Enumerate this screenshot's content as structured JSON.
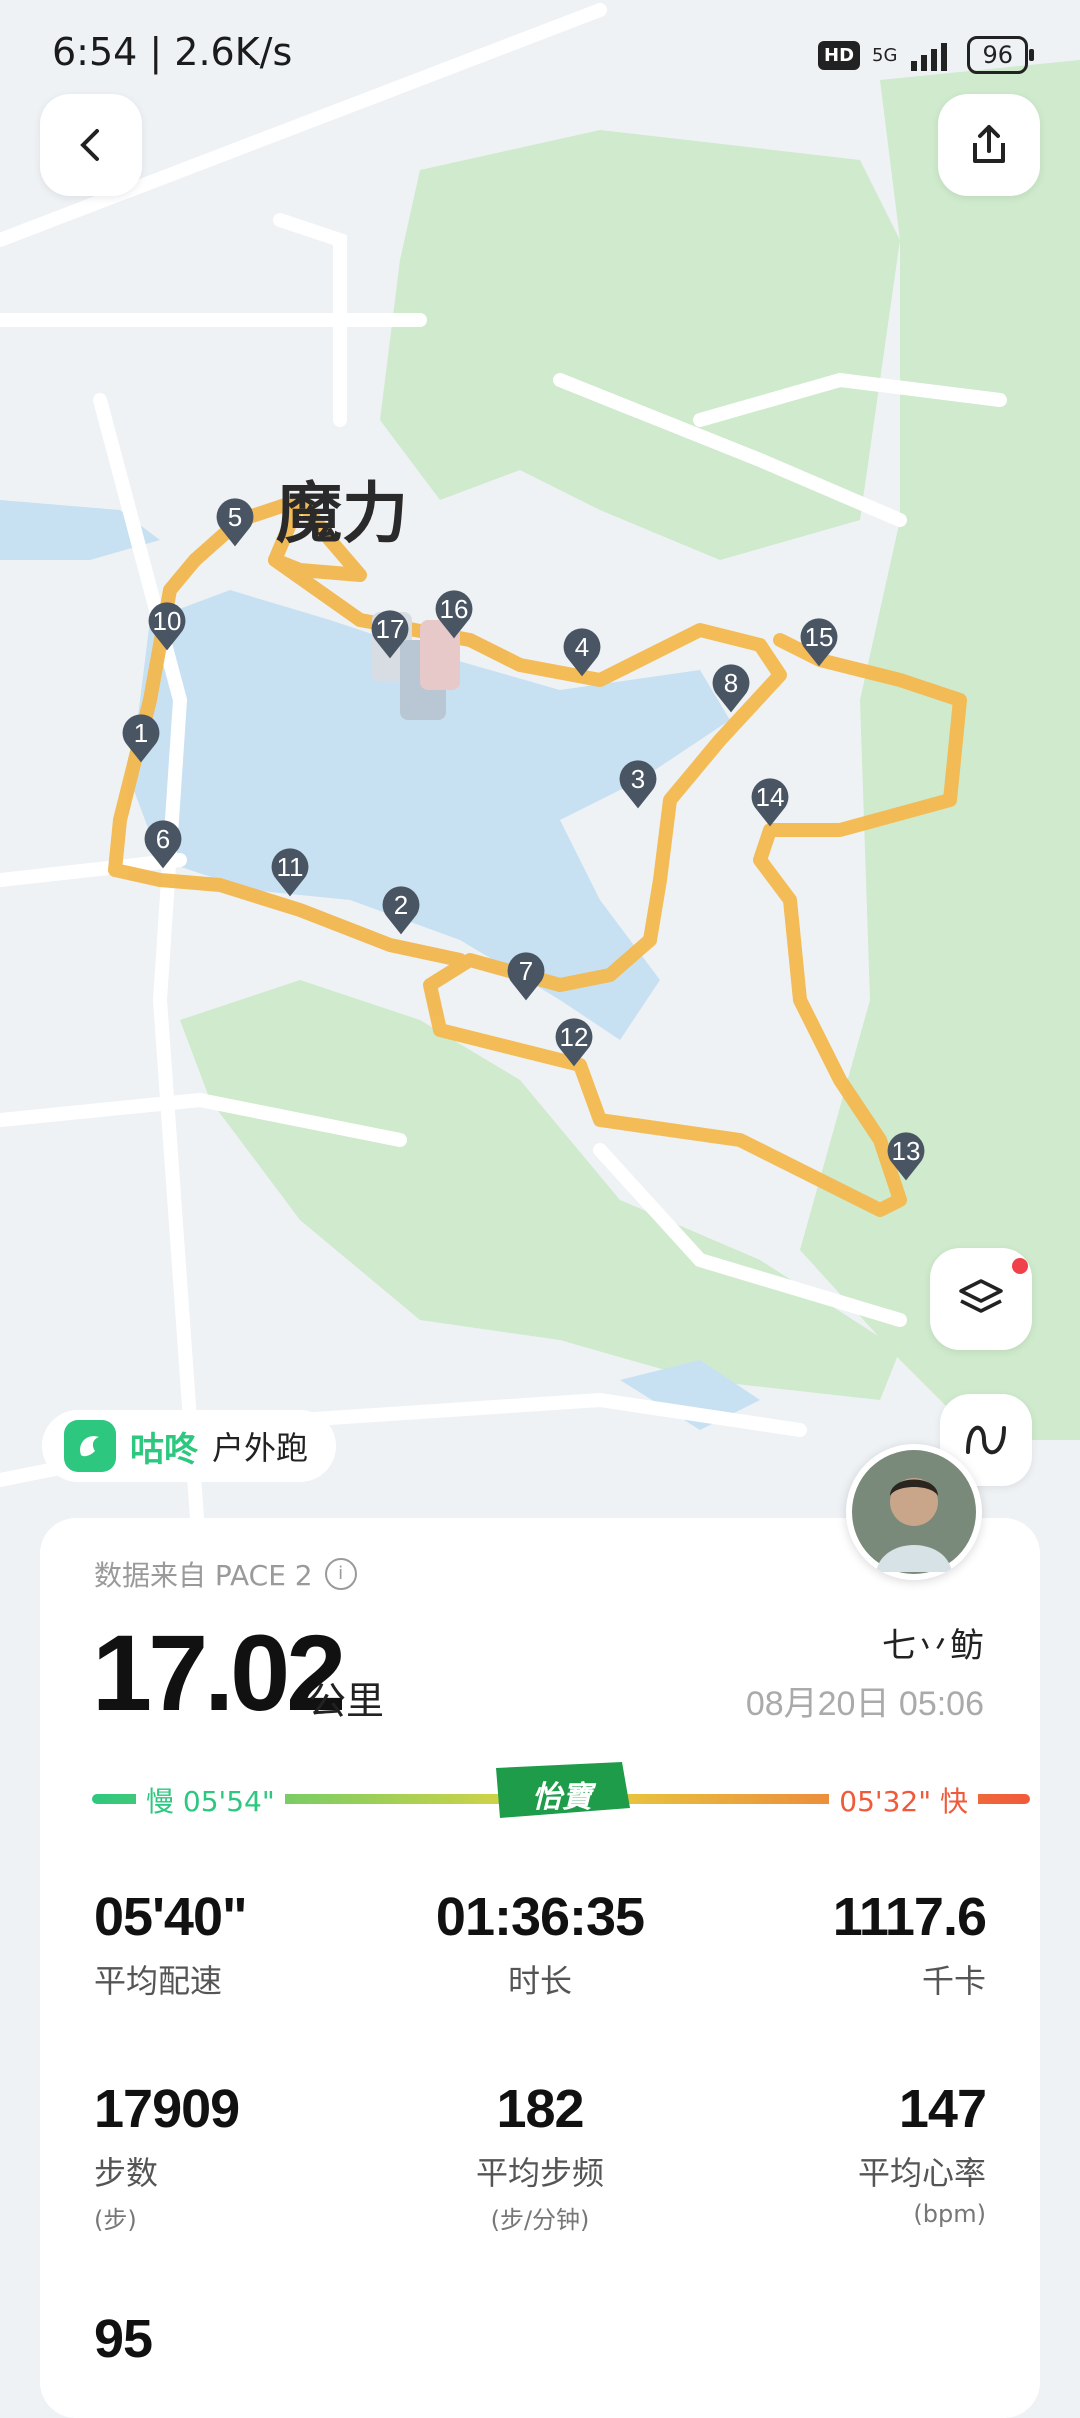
{
  "status_bar": {
    "time": "6:54 | 2.6K/s",
    "hd": "HD",
    "signal": "5G",
    "battery": "96"
  },
  "map": {
    "label": "魔力",
    "markers": [
      "5",
      "10",
      "1",
      "6",
      "11",
      "2",
      "7",
      "12",
      "13",
      "14",
      "3",
      "8",
      "15",
      "4",
      "16",
      "17"
    ]
  },
  "brand": {
    "name": "咕咚",
    "mode": "户外跑"
  },
  "user": {
    "name": "七丷鲂"
  },
  "summary": {
    "source": "数据来自 PACE 2",
    "distance": "17.02",
    "distance_unit": "公里",
    "date": "08月20日 05:06",
    "pace_slow_label": "慢 05'54\"",
    "pace_fast_label": "05'32\" 快",
    "sponsor": "怡寶"
  },
  "stats": [
    {
      "value": "05'40\"",
      "label": "平均配速",
      "unit": ""
    },
    {
      "value": "01:36:35",
      "label": "时长",
      "unit": ""
    },
    {
      "value": "1117.6",
      "label": "千卡",
      "unit": ""
    },
    {
      "value": "17909",
      "label": "步数",
      "unit": "(步)"
    },
    {
      "value": "182",
      "label": "平均步频",
      "unit": "(步/分钟)"
    },
    {
      "value": "147",
      "label": "平均心率",
      "unit": "(bpm)"
    },
    {
      "value": "95",
      "label": "",
      "unit": ""
    }
  ],
  "colors": {
    "accent": "#2ec77f",
    "fast": "#f05a3a",
    "route": "#f3b84e",
    "pin": "#4a5563"
  }
}
